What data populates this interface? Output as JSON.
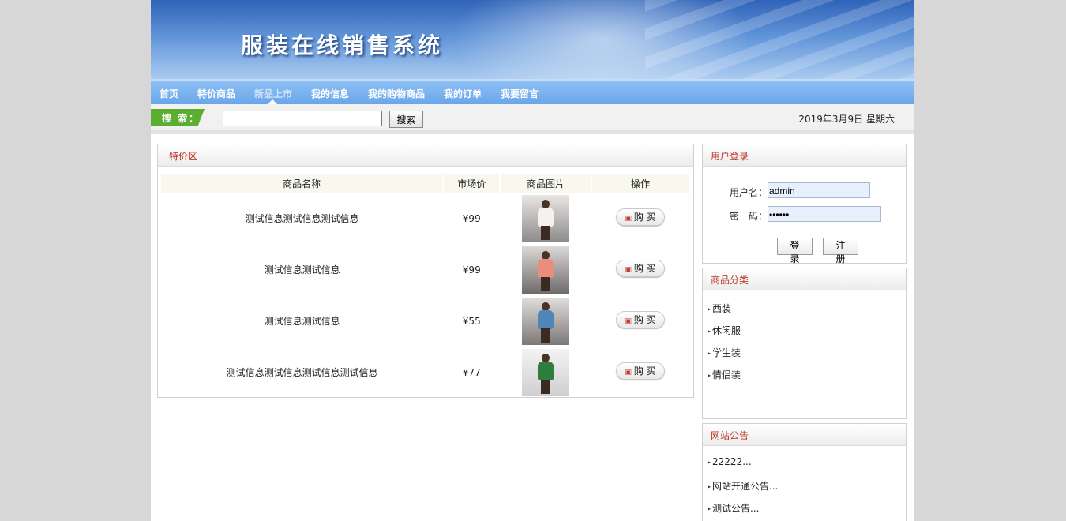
{
  "banner": {
    "title": "服装在线销售系统"
  },
  "nav": {
    "items": [
      {
        "label": "首页"
      },
      {
        "label": "特价商品"
      },
      {
        "label": "新品上市"
      },
      {
        "label": "我的信息"
      },
      {
        "label": "我的购物商品"
      },
      {
        "label": "我的订单"
      },
      {
        "label": "我要留言"
      }
    ],
    "active_index": 2
  },
  "search": {
    "tag_label": "搜 索：",
    "value": "",
    "button_label": "搜索"
  },
  "date_text": "2019年3月9日  星期六",
  "special": {
    "title": "特价区",
    "columns": [
      "商品名称",
      "市场价",
      "商品图片",
      "操作"
    ],
    "rows": [
      {
        "name": "测试信息测试信息测试信息",
        "price": "¥99",
        "image_icon": "coat-white-model-photo",
        "buy_label": "购 买"
      },
      {
        "name": "测试信息测试信息",
        "price": "¥99",
        "image_icon": "coat-pink-model-photo",
        "buy_label": "购 买"
      },
      {
        "name": "测试信息测试信息",
        "price": "¥55",
        "image_icon": "jacket-blue-model-photo",
        "buy_label": "购 买"
      },
      {
        "name": "测试信息测试信息测试信息测试信息",
        "price": "¥77",
        "image_icon": "coat-green-model-photo",
        "buy_label": "购 买"
      }
    ]
  },
  "login": {
    "title": "用户登录",
    "username_label": "用户名：",
    "username_value": "admin",
    "password_label": "密　码：",
    "password_value": "••••••",
    "login_button": "登 录",
    "register_button": "注 册"
  },
  "category": {
    "title": "商品分类",
    "items": [
      {
        "label": "西装"
      },
      {
        "label": "休闲服"
      },
      {
        "label": "学生装"
      },
      {
        "label": "情侣装"
      }
    ]
  },
  "notice": {
    "title": "网站公告",
    "items": [
      {
        "label": "22222..."
      },
      {
        "label": "网站开通公告..."
      },
      {
        "label": "测试公告..."
      }
    ]
  },
  "colors": {
    "nav_bg": "#6aa6ea",
    "panel_title": "#c0392b",
    "search_tag": "#5cae30",
    "page_bg": "#d7d7d7"
  }
}
